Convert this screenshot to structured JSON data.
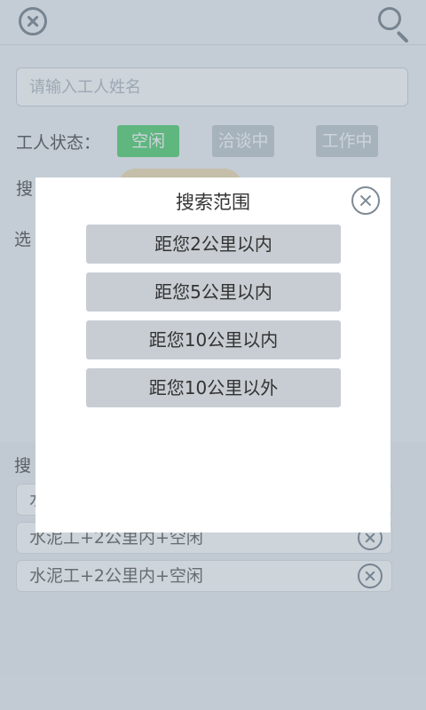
{
  "header": {
    "close_icon": "close-circle-icon",
    "search_icon": "search-icon"
  },
  "search": {
    "placeholder": "请输入工人姓名"
  },
  "filters": {
    "status_label": "工人状态：",
    "status_chips": [
      "空闲",
      "洽谈中",
      "工作中"
    ],
    "range_label": "搜",
    "select_label": "选"
  },
  "history": {
    "label": "搜",
    "items": [
      "水",
      "水泥工+2公里内+空闲",
      "水泥工+2公里内+空闲"
    ]
  },
  "modal": {
    "title": "搜索范围",
    "options": [
      "距您2公里以内",
      "距您5公里以内",
      "距您10公里以内",
      "距您10公里以外"
    ]
  },
  "colors": {
    "chip_active": "#5dd37a",
    "chip_inactive": "#c6cdd3",
    "option_bg": "#c7cdd2"
  }
}
